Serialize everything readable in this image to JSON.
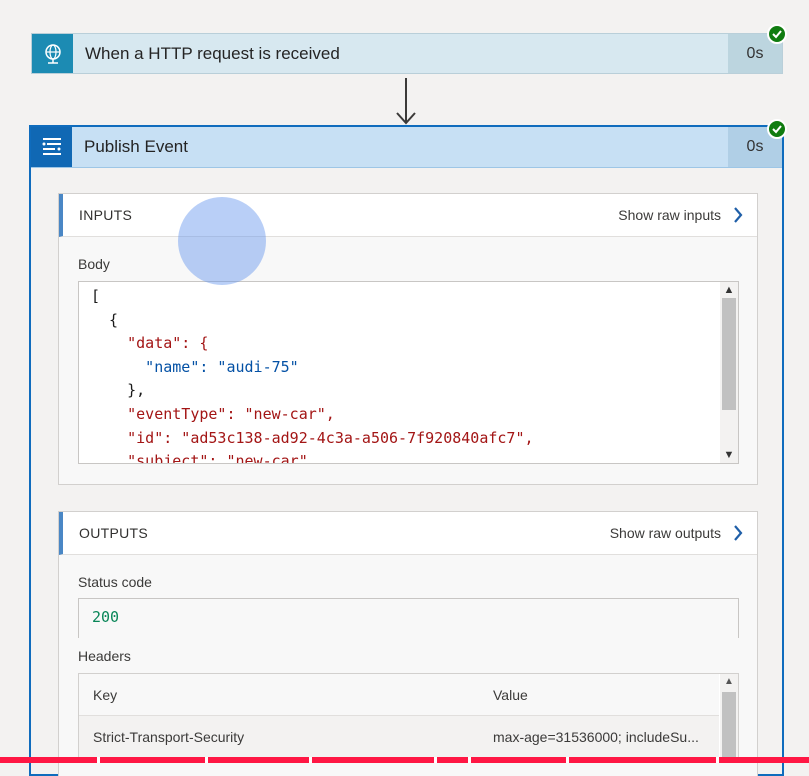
{
  "trigger": {
    "title": "When a HTTP request is received",
    "duration": "0s",
    "icon": "globe-icon",
    "status": "succeeded"
  },
  "action": {
    "title": "Publish Event",
    "duration": "0s",
    "icon": "event-grid-icon",
    "status": "succeeded"
  },
  "inputs": {
    "heading": "INPUTS",
    "raw_link": "Show raw inputs",
    "body_label": "Body",
    "body_lines": [
      "[",
      "  {",
      "    \"data\": {",
      "      \"name\": \"audi-75\"",
      "    },",
      "    \"eventType\": \"new-car\",",
      "    \"id\": \"ad53c138-ad92-4c3a-a506-7f920840afc7\",",
      "    \"subject\": \"new-car\""
    ]
  },
  "outputs": {
    "heading": "OUTPUTS",
    "raw_link": "Show raw outputs",
    "status_label": "Status code",
    "status_value": "200",
    "headers_label": "Headers",
    "headers_columns": [
      "Key",
      "Value"
    ],
    "headers_rows": [
      {
        "key": "Strict-Transport-Security",
        "value": "max-age=31536000; includeSu..."
      }
    ]
  },
  "colors": {
    "accent": "#0f6cbd",
    "success": "#107c10",
    "progress": "#ff1744"
  }
}
